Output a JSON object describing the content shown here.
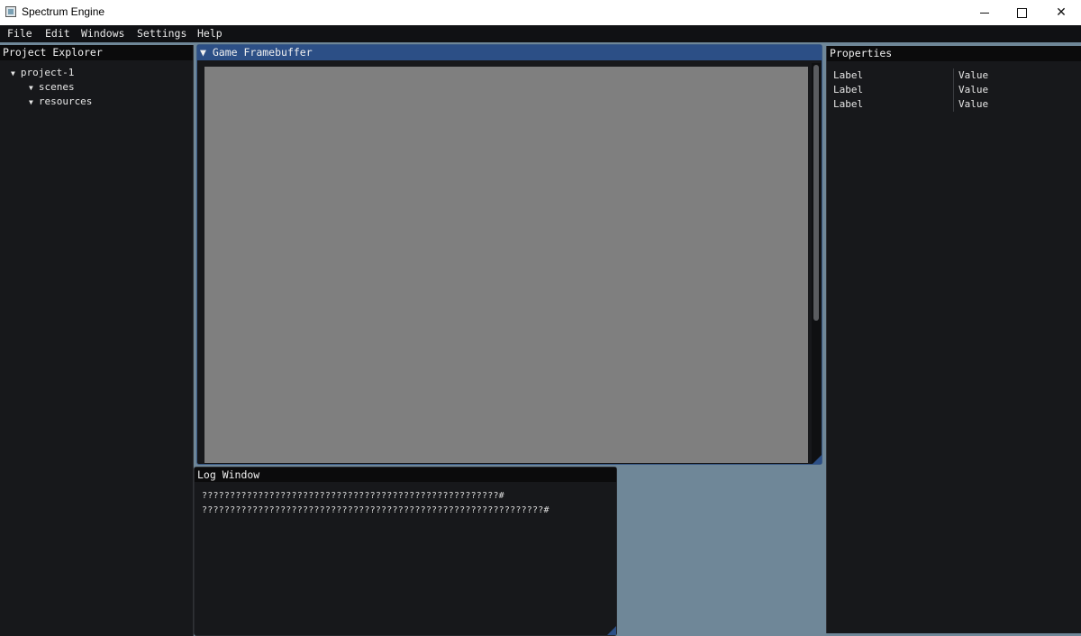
{
  "window": {
    "title": "Spectrum Engine",
    "minimize_icon": "minimize-icon",
    "maximize_icon": "maximize-icon",
    "close_icon": "close-icon",
    "close_glyph": "✕"
  },
  "menubar": {
    "items": [
      "File",
      "Edit",
      "Windows",
      "Settings",
      "Help"
    ]
  },
  "project_explorer": {
    "title": "Project Explorer",
    "tree": [
      {
        "label": "project-1",
        "expanded": true,
        "arrow": "▼"
      },
      {
        "label": "scenes",
        "expanded": true,
        "arrow": "▼"
      },
      {
        "label": "resources",
        "expanded": true,
        "arrow": "▼"
      }
    ]
  },
  "framebuffer": {
    "title": "Game Framebuffer",
    "arrow": "▼"
  },
  "properties": {
    "title": "Properties",
    "rows": [
      {
        "label": "Label",
        "value": "Value"
      },
      {
        "label": "Label",
        "value": "Value"
      },
      {
        "label": "Label",
        "value": "Value"
      }
    ]
  },
  "log_window": {
    "title": "Log Window",
    "lines": [
      "?????????????????????????????????????????????????????#",
      "?????????????????????????????????????????????????????????????#"
    ]
  },
  "colors": {
    "background": "#6f8798",
    "panel": "#17181b",
    "header": "#0b0b0c",
    "active_header": "#2c4f86",
    "framebuffer": "#7f7f7f"
  }
}
